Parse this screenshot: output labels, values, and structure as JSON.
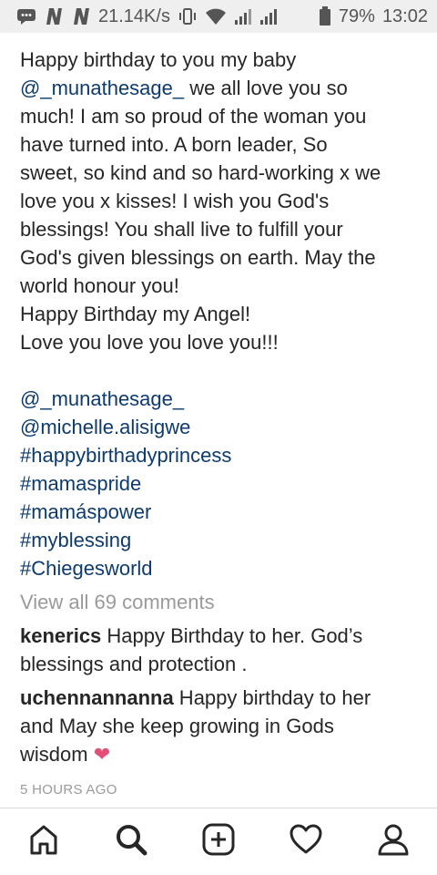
{
  "status_bar": {
    "speed": "21.14K/s",
    "battery": "79%",
    "time": "13:02",
    "icons": [
      "message-icon",
      "n-icon",
      "n-icon",
      "vibrate-icon",
      "wifi-icon",
      "signal-icon",
      "signal-icon",
      "battery-icon"
    ]
  },
  "post": {
    "caption": {
      "line1": "Happy birthday to you my baby",
      "mention1": "@_munathesage_",
      "line2_rest": " we all love you so",
      "line3": "much! I am so proud of the woman you",
      "line4": "have turned into. A born leader, So",
      "line5": "sweet, so kind and so hard-working x we",
      "line6": "love you x kisses! I wish you God's",
      "line7": "blessings! You shall live to fulfill your",
      "line8": "God's given blessings on earth. May the",
      "line9": "world honour you!",
      "line10": "Happy Birthday my Angel!",
      "line11": "Love you love you love you!!!"
    },
    "tags": [
      "@_munathesage_",
      "@michelle.alisigwe",
      "#happybirthadyprincess",
      "#mamaspride",
      "#mamáspower",
      "#myblessing",
      "#Chiegesworld"
    ],
    "view_comments": "View all 69 comments",
    "comments": [
      {
        "user": "kenerics",
        "text_line1": " Happy Birthday to her. God’s",
        "text_line2": "blessings and protection ."
      },
      {
        "user": "uchennannanna",
        "text_line1": " Happy birthday to her",
        "text_line2": "and May she keep growing in Gods",
        "text_line3": "wisdom ",
        "emoji": "❤"
      }
    ],
    "timestamp": "5 HOURS AGO"
  },
  "nav": {
    "items": [
      "home-icon",
      "search-icon",
      "new-post-icon",
      "activity-icon",
      "profile-icon"
    ]
  }
}
